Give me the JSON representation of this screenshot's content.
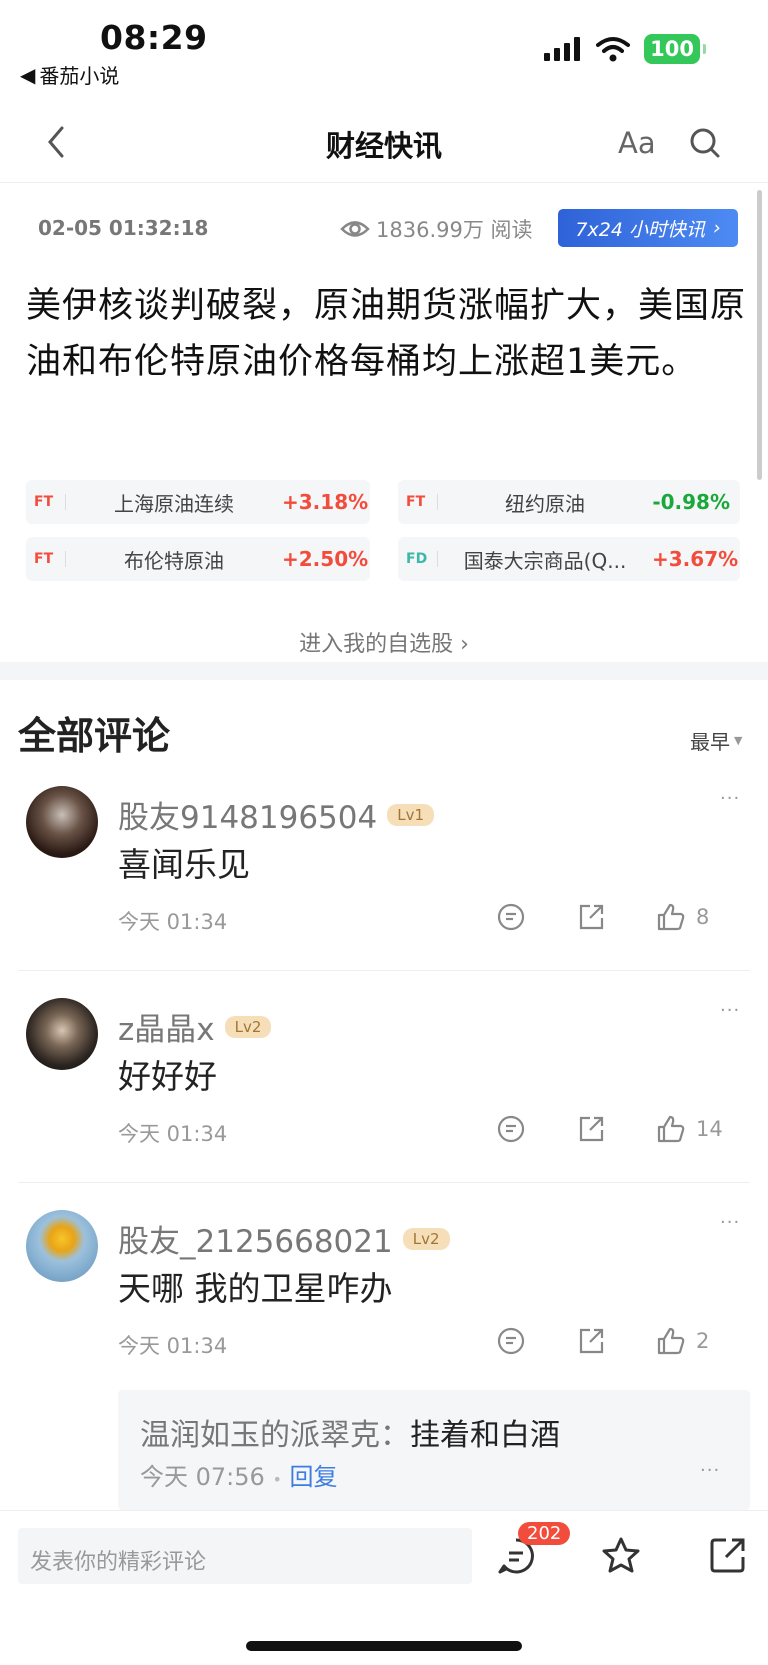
{
  "status_bar": {
    "time": "08:29",
    "back_app": "番茄小说",
    "battery": "100"
  },
  "nav": {
    "title": "财经快讯",
    "font_label": "Aa"
  },
  "news": {
    "timestamp": "02-05 01:32:18",
    "views": "1836.99万 阅读",
    "badge": "7x24 小时快讯",
    "headline": "美伊核谈判破裂，原油期货涨幅扩大，美国原油和布伦特原油价格每桶均上涨超1美元。",
    "stocks": [
      {
        "tag": "FT",
        "name": "上海原油连续",
        "pct": "+3.18%"
      },
      {
        "tag": "FT",
        "name": "纽约原油",
        "pct": "-0.98%"
      },
      {
        "tag": "FT",
        "name": "布伦特原油",
        "pct": "+2.50%"
      },
      {
        "tag": "FD",
        "name": "国泰大宗商品(Q...",
        "pct": "+3.67%"
      }
    ],
    "enter_label": "进入我的自选股"
  },
  "comments_section": {
    "title": "全部评论",
    "sort": "最早"
  },
  "comments": [
    {
      "user": "股友9148196504",
      "level": "Lv1",
      "text": "喜闻乐见",
      "time": "今天 01:34",
      "likes": "8"
    },
    {
      "user": "z晶晶x",
      "level": "Lv2",
      "text": "好好好",
      "time": "今天 01:34",
      "likes": "14"
    },
    {
      "user": "股友_2125668021",
      "level": "Lv2",
      "text": "天哪 我的卫星咋办",
      "time": "今天 01:34",
      "likes": "2"
    }
  ],
  "reply": {
    "user": "温润如玉的派翠克：",
    "text": "挂着和白酒",
    "time": "今天 07:56",
    "dot": "•",
    "reply_label": "回复"
  },
  "bottom": {
    "placeholder": "发表你的精彩评论",
    "comment_count": "202"
  },
  "colors": {
    "up": "#f24c3d",
    "down": "#1aa83a",
    "accent": "#2f62d8"
  }
}
